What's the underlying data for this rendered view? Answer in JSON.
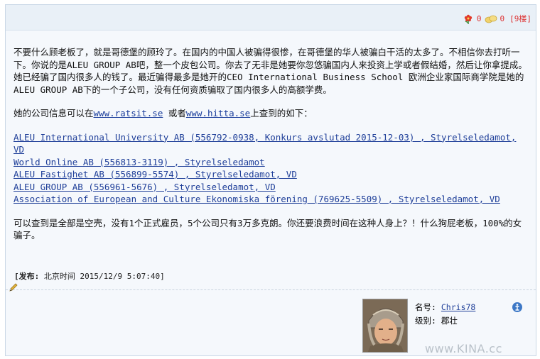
{
  "toolbar": {
    "flower_count": "0",
    "egg_count": "0",
    "floor_label": "[9楼]"
  },
  "post": {
    "para1": "不要什么顾老板了，就是哥德堡的顾玲了。在国内的中国人被骗得很惨，在哥德堡的华人被骗白干活的太多了。不相信你去打听一下。你说的是ALEU GROUP AB吧，整一个皮包公司。你去了无非是她要你忽悠骗国内人来投资上学或者假结婚，然后让你拿提成。她已经骗了国内很多人的钱了。最近骗得最多是她开的CEO International Business School 欧洲企业家国际商学院是她的ALEU GROUP AB下的一个子公司，没有任何资质骗取了国内很多人的高额学费。",
    "para2_prefix": "她的公司信息可以在",
    "site1": "www.ratsit.se",
    "para2_mid": " 或者",
    "site2": "www.hitta.se",
    "para2_suffix": "上查到的如下：",
    "links": [
      "ALEU International University AB (556792-0938, Konkurs avslutad 2015-12-03) , Styrelseledamot, VD",
      "World Online AB (556813-3119) , Styrelseledamot",
      "ALEU Fastighet AB (556899-5574) , Styrelseledamot, VD",
      "ALEU GROUP AB (556961-5676) , Styrelseledamot, VD",
      "Association of European and Culture Ekonomiska förening (769625-5509) , Styrelseledamot, VD"
    ],
    "para3": "可以查到是全部是空壳，没有1个正式雇员，5个公司只有3万多克朗。你还要浪费时间在这种人身上？！什么狗屁老板，100%的女骗子。"
  },
  "meta": {
    "label": "[发布:",
    "zone": "北京时间",
    "time": "2015/12/9 5:07:40]"
  },
  "author": {
    "name_label": "名号:",
    "name": "Chris78",
    "rank_label": "级别:",
    "rank": "郡壮"
  },
  "watermark": "www.KINA.cc"
}
